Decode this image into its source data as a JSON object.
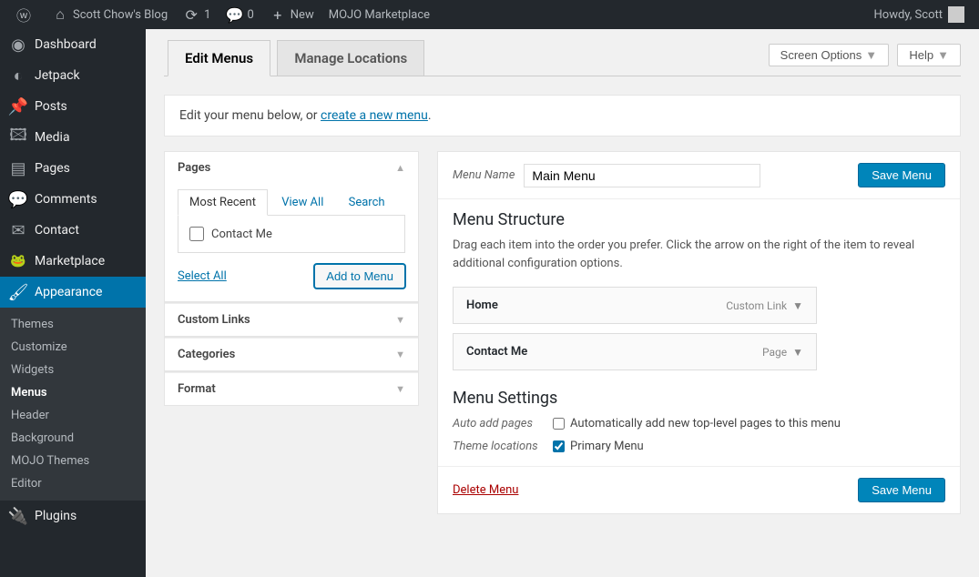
{
  "adminbar": {
    "site_name": "Scott Chow's Blog",
    "updates": "1",
    "comments": "0",
    "new": "New",
    "mojo": "MOJO Marketplace",
    "howdy": "Howdy, Scott"
  },
  "sidebar": {
    "items": [
      {
        "label": "Dashboard"
      },
      {
        "label": "Jetpack"
      },
      {
        "label": "Posts"
      },
      {
        "label": "Media"
      },
      {
        "label": "Pages"
      },
      {
        "label": "Comments"
      },
      {
        "label": "Contact"
      },
      {
        "label": "Marketplace"
      },
      {
        "label": "Appearance"
      },
      {
        "label": "Plugins"
      }
    ],
    "submenu": [
      "Themes",
      "Customize",
      "Widgets",
      "Menus",
      "Header",
      "Background",
      "MOJO Themes",
      "Editor"
    ]
  },
  "top": {
    "screen_options": "Screen Options",
    "help": "Help"
  },
  "tabs": {
    "edit": "Edit Menus",
    "locations": "Manage Locations"
  },
  "notice": {
    "prefix": "Edit your menu below, or ",
    "link": "create a new menu",
    "suffix": "."
  },
  "pages_box": {
    "title": "Pages",
    "tabs": {
      "recent": "Most Recent",
      "all": "View All",
      "search": "Search"
    },
    "items": [
      {
        "label": "Contact Me"
      }
    ],
    "select_all": "Select All",
    "add_btn": "Add to Menu"
  },
  "accordions": {
    "custom_links": "Custom Links",
    "categories": "Categories",
    "format": "Format"
  },
  "menu": {
    "name_label": "Menu Name",
    "name_value": "Main Menu",
    "save_btn": "Save Menu",
    "structure_title": "Menu Structure",
    "structure_desc": "Drag each item into the order you prefer. Click the arrow on the right of the item to reveal additional configuration options.",
    "items": [
      {
        "title": "Home",
        "type": "Custom Link"
      },
      {
        "title": "Contact Me",
        "type": "Page"
      }
    ],
    "settings_title": "Menu Settings",
    "auto_add_label": "Auto add pages",
    "auto_add_text": "Automatically add new top-level pages to this menu",
    "theme_loc_label": "Theme locations",
    "theme_loc_text": "Primary Menu",
    "delete": "Delete Menu"
  }
}
